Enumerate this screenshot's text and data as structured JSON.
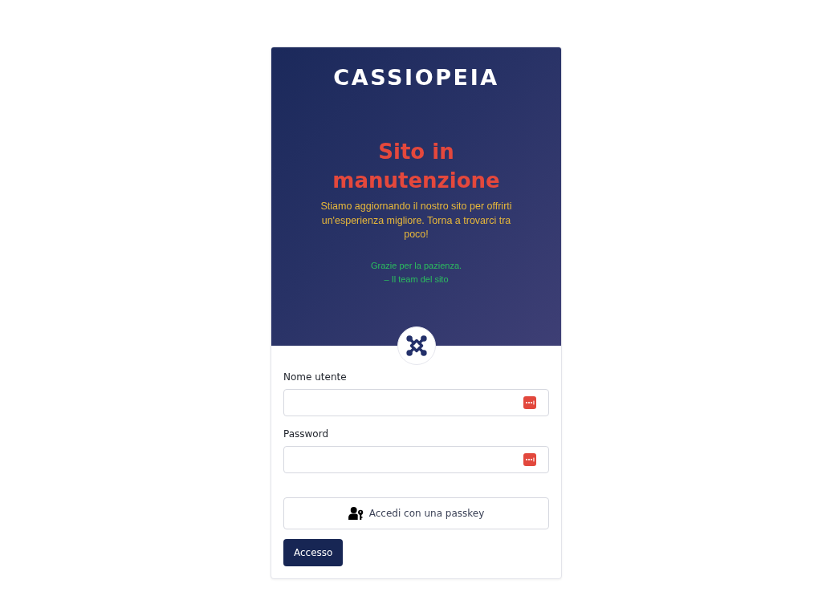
{
  "header": {
    "logo": "CASSIOPEIA",
    "title": "Sito in manutenzione",
    "message": "Stiamo aggiornando il nostro sito per offrirti un'esperienza migliore. Torna a trovarci tra poco!",
    "signature_lines": [
      "Grazie per la pazienza.",
      "– Il team del sito"
    ]
  },
  "form": {
    "fields": [
      {
        "label": "Nome utente"
      },
      {
        "label": "Password"
      }
    ],
    "passkey_button": "Accedi con una passkey",
    "submit_button": "Accesso"
  }
}
